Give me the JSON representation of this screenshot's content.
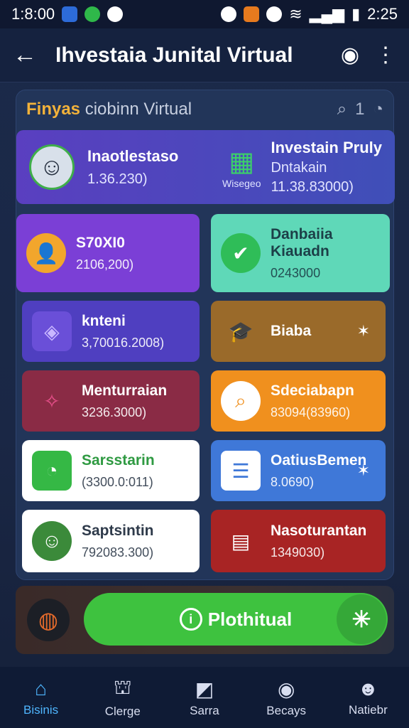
{
  "status": {
    "time_left": "1:8:00",
    "time_right": "2:25"
  },
  "appbar": {
    "title": "Ihvestaia Junital Virtual"
  },
  "panel": {
    "title_highlight": "Finyas",
    "title_rest": "ciobinn Virtual",
    "count": "1"
  },
  "hero": {
    "name": "Inaotlestaso",
    "value": "1.36.230)",
    "right_title": "Investain Pruly",
    "right_sub": "Dntakain",
    "right_caption": "Wisegeo",
    "right_value": "11.38.83000)"
  },
  "cards": [
    {
      "label": "S70XI0",
      "value": "2106,200)",
      "icon": "person-icon"
    },
    {
      "label": "Danbaiia Kiauadn",
      "value": "0243000",
      "icon": "check-icon"
    },
    {
      "label": "knteni",
      "value": "3,70016.2008)",
      "icon": "chat-icon"
    },
    {
      "label": "Biaba",
      "value": "",
      "icon": "graduation-icon"
    },
    {
      "label": "Menturraian",
      "value": "3236.3000)",
      "icon": "star-icon"
    },
    {
      "label": "Sdeciabapn",
      "value": "83094(83960)",
      "icon": "search-icon"
    },
    {
      "label": "Sarsstarin",
      "value": "(3300.0:011)",
      "icon": "message-icon"
    },
    {
      "label": "OatiusBemen",
      "value": "8.0690)",
      "icon": "clipboard-icon"
    },
    {
      "label": "Saptsintin",
      "value": "792083.300)",
      "icon": "person-icon"
    },
    {
      "label": "Nasoturantan",
      "value": "1349030)",
      "icon": "document-icon"
    }
  ],
  "fab": {
    "label": "Plothitual"
  },
  "nav": [
    {
      "label": "Bisinis",
      "icon": "home-icon"
    },
    {
      "label": "Clerge",
      "icon": "bank-icon"
    },
    {
      "label": "Sarra",
      "icon": "chart-icon"
    },
    {
      "label": "Becays",
      "icon": "notification-icon"
    },
    {
      "label": "Natiebr",
      "icon": "profile-icon"
    }
  ],
  "colors": {
    "purple": "#7b3fd6",
    "teal": "#5fd8b8",
    "indigo": "#4f3fc0",
    "brown": "#9a6a2a",
    "maroon": "#8a2b45",
    "orange": "#f0901e",
    "white": "#ffffff",
    "blue": "#3f78d8",
    "red": "#a82424",
    "green": "#3ec23f"
  }
}
